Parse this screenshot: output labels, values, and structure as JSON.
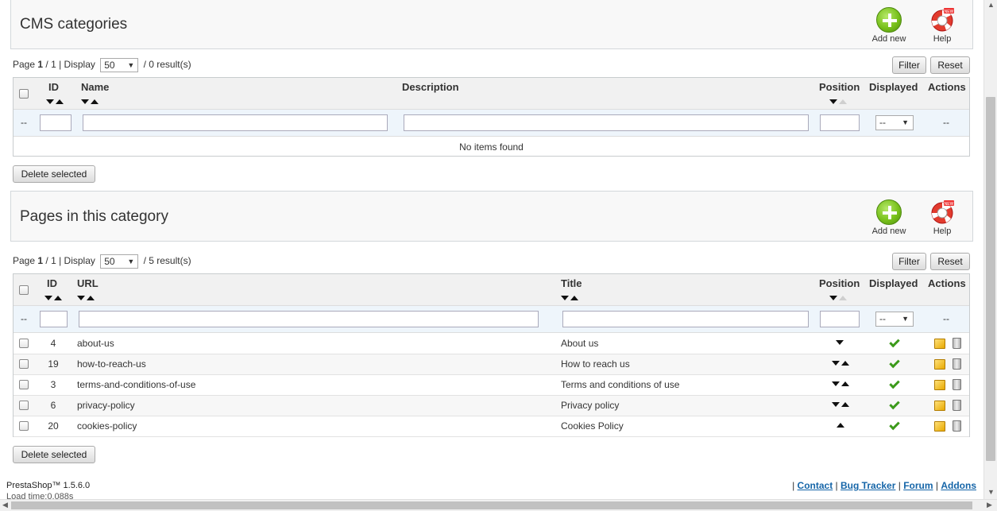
{
  "cms_categories": {
    "title": "CMS categories",
    "add_new": "Add new",
    "help": "Help",
    "pager": {
      "page_label": "Page",
      "page": "1",
      "pages": "/ 1",
      "display_label": "| Display",
      "per_page": "50",
      "results": "/ 0 result(s)"
    },
    "filter_btn": "Filter",
    "reset_btn": "Reset",
    "columns": {
      "id": "ID",
      "name": "Name",
      "description": "Description",
      "position": "Position",
      "displayed": "Displayed",
      "actions": "Actions"
    },
    "filter_row": {
      "dash": "--",
      "displayed_value": "--",
      "actions_dash": "--"
    },
    "empty_message": "No items found",
    "delete_selected": "Delete selected"
  },
  "pages_in_category": {
    "title": "Pages in this category",
    "add_new": "Add new",
    "help": "Help",
    "pager": {
      "page_label": "Page",
      "page": "1",
      "pages": "/ 1",
      "display_label": "| Display",
      "per_page": "50",
      "results": "/ 5 result(s)"
    },
    "filter_btn": "Filter",
    "reset_btn": "Reset",
    "columns": {
      "id": "ID",
      "url": "URL",
      "title": "Title",
      "position": "Position",
      "displayed": "Displayed",
      "actions": "Actions"
    },
    "filter_row": {
      "dash": "--",
      "displayed_value": "--",
      "actions_dash": "--"
    },
    "rows": [
      {
        "id": "4",
        "url": "about-us",
        "title": "About us",
        "position_arrows": "down",
        "displayed": true
      },
      {
        "id": "19",
        "url": "how-to-reach-us",
        "title": "How to reach us",
        "position_arrows": "both",
        "displayed": true
      },
      {
        "id": "3",
        "url": "terms-and-conditions-of-use",
        "title": "Terms and conditions of use",
        "position_arrows": "both",
        "displayed": true
      },
      {
        "id": "6",
        "url": "privacy-policy",
        "title": "Privacy policy",
        "position_arrows": "both",
        "displayed": true
      },
      {
        "id": "20",
        "url": "cookies-policy",
        "title": "Cookies Policy",
        "position_arrows": "up",
        "displayed": true
      }
    ],
    "delete_selected": "Delete selected"
  },
  "footer": {
    "version": "PrestaShop™ 1.5.6.0",
    "load_time": "Load time:0.088s",
    "links": [
      "Contact",
      "Bug Tracker",
      "Forum",
      "Addons"
    ]
  },
  "colors": {
    "accent_link": "#1565a8",
    "check": "#3c9a1b",
    "filter_row_bg": "#eef5fb"
  },
  "icons": [
    "add-icon",
    "help-lifebuoy-icon",
    "checkmark-icon",
    "edit-icon",
    "delete-icon"
  ]
}
